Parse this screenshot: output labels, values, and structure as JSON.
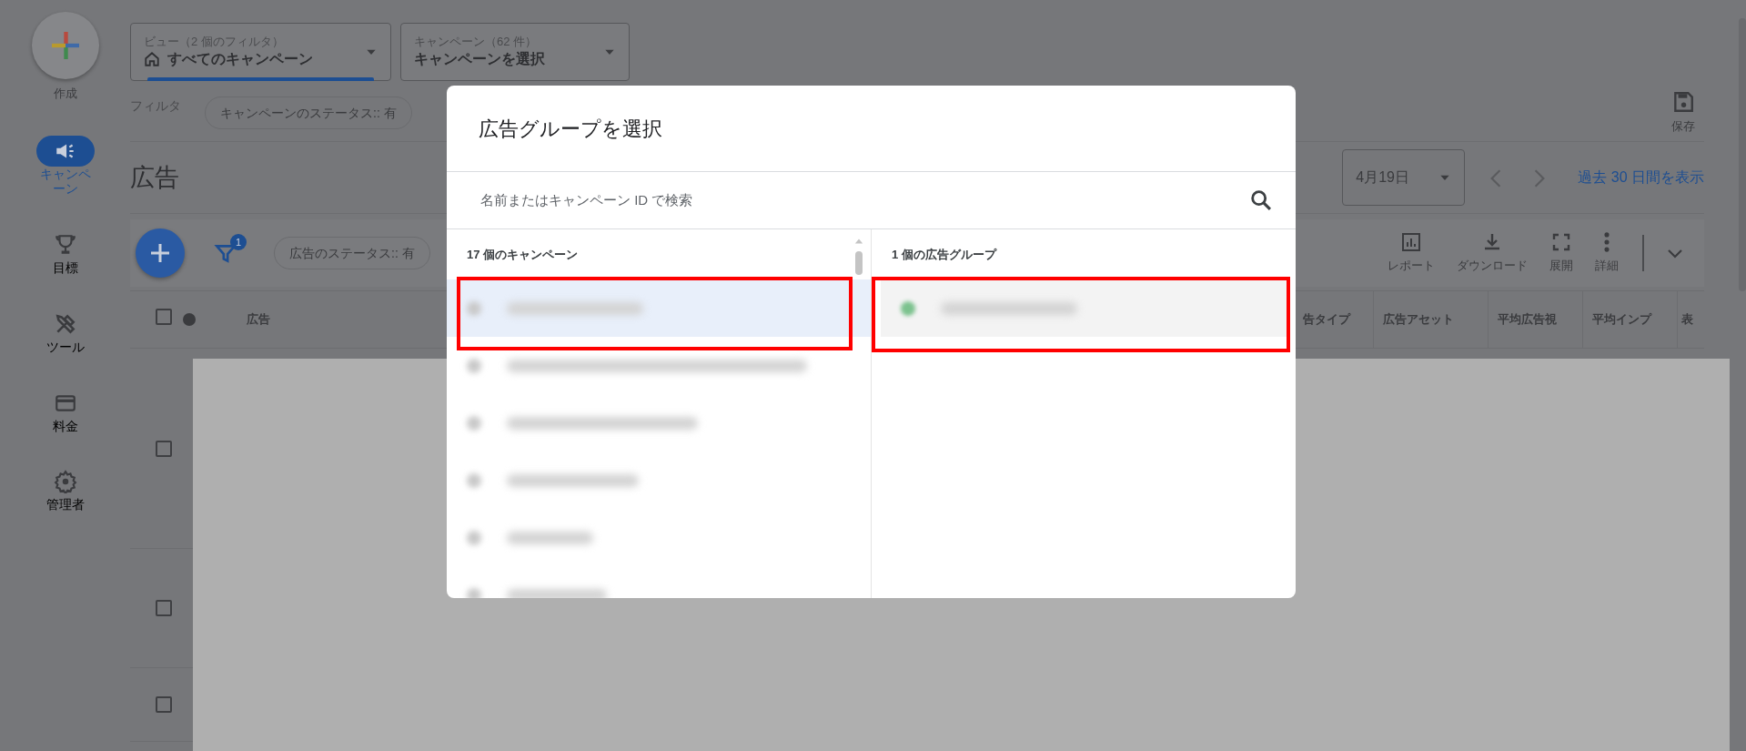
{
  "sidebar": {
    "create_label": "作成",
    "items": [
      {
        "kind": "campaigns",
        "label": "キャンペーン",
        "selected": true
      },
      {
        "kind": "goals",
        "label": "目標",
        "selected": false
      },
      {
        "kind": "tools",
        "label": "ツール",
        "selected": false
      },
      {
        "kind": "billing",
        "label": "料金",
        "selected": false
      },
      {
        "kind": "admin",
        "label": "管理者",
        "selected": false
      }
    ]
  },
  "header": {
    "view_selector": {
      "label": "ビュー（2 個のフィルタ）",
      "value": "すべてのキャンペーン"
    },
    "campaign_selector": {
      "label": "キャンペーン（62 件）",
      "value": "キャンペーンを選択"
    },
    "filter_label": "フィルタ",
    "filter_chip": "キャンペーンのステータス:: 有",
    "save_label": "保存"
  },
  "page": {
    "title": "広告",
    "date_range": "4月19日",
    "link": "過去 30 日間を表示"
  },
  "toolbar": {
    "filter_count": "1",
    "chip": "広告のステータス:: 有",
    "actions": [
      {
        "kind": "report",
        "label": "レポート"
      },
      {
        "kind": "download",
        "label": "ダウンロード"
      },
      {
        "kind": "expand",
        "label": "展開"
      },
      {
        "kind": "more",
        "label": "詳細"
      }
    ]
  },
  "table": {
    "select_all_checked": false,
    "columns": [
      "広告",
      "告タイプ",
      "広告アセット",
      "平均広告視",
      "平均インプ",
      "表"
    ],
    "rows": [
      {
        "checked": false
      },
      {
        "checked": false
      },
      {
        "checked": false
      }
    ]
  },
  "dialog": {
    "title": "広告グループを選択",
    "search": {
      "placeholder": "名前またはキャンペーン ID で検索"
    },
    "campaigns": {
      "heading": "17 個のキャンペーン",
      "rows": [
        {
          "selected": true
        },
        {
          "selected": false
        },
        {
          "selected": false
        },
        {
          "selected": false
        },
        {
          "selected": false
        },
        {
          "selected": false
        }
      ]
    },
    "ad_groups": {
      "heading": "1 個の広告グループ",
      "rows": [
        {
          "selected": true
        }
      ]
    }
  }
}
